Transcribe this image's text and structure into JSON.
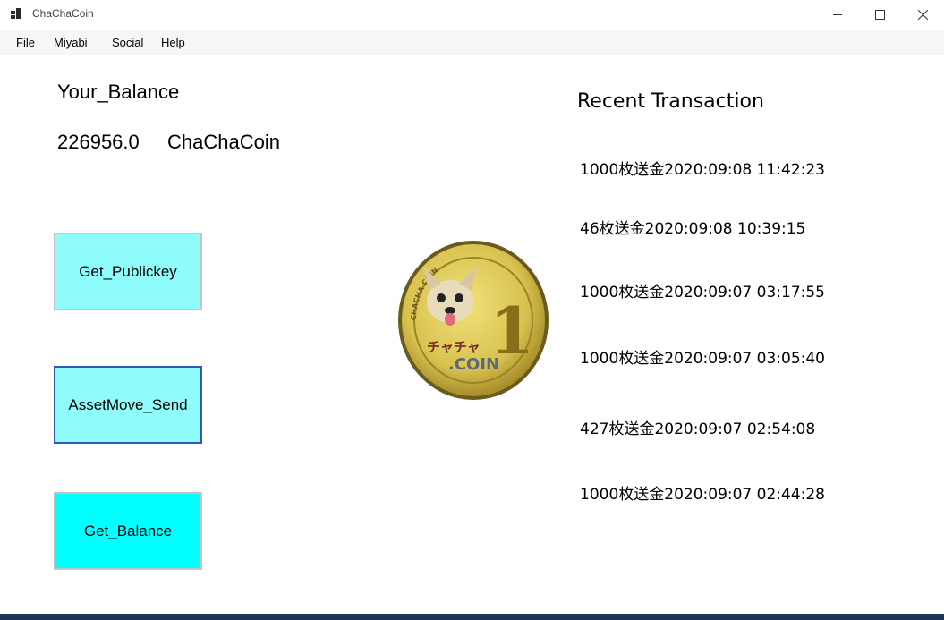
{
  "window": {
    "title": "ChaChaCoin",
    "controls": {
      "minimize": "minimize-icon",
      "maximize": "maximize-icon",
      "close": "close-icon"
    }
  },
  "menu": [
    "File",
    "Miyabi",
    "Social",
    "Help"
  ],
  "balance": {
    "title": "Your_Balance",
    "value": "226956.0",
    "unit": "ChaChaCoin"
  },
  "buttons": {
    "get_publickey": "Get_Publickey",
    "assetmove_send": "AssetMove_Send",
    "get_balance": "Get_Balance"
  },
  "logo": {
    "text_top": "CHACHA COIN",
    "number": "1",
    "text_katakana": "チャチャ",
    "text_coin": ".COIN"
  },
  "recent": {
    "title": "Recent Transaction",
    "items": [
      "1000枚送金2020:09:08 11:42:23",
      "46枚送金2020:09:08 10:39:15",
      "1000枚送金2020:09:07 03:17:55",
      "1000枚送金2020:09:07 03:05:40",
      "427枚送金2020:09:07 02:54:08",
      "1000枚送金2020:09:07 02:44:28"
    ]
  },
  "colors": {
    "button_light": "#8ffcfc",
    "button_cyan": "#00ffff",
    "focus_border": "#2e5bb5",
    "coin_gold": "#d8c24f"
  }
}
